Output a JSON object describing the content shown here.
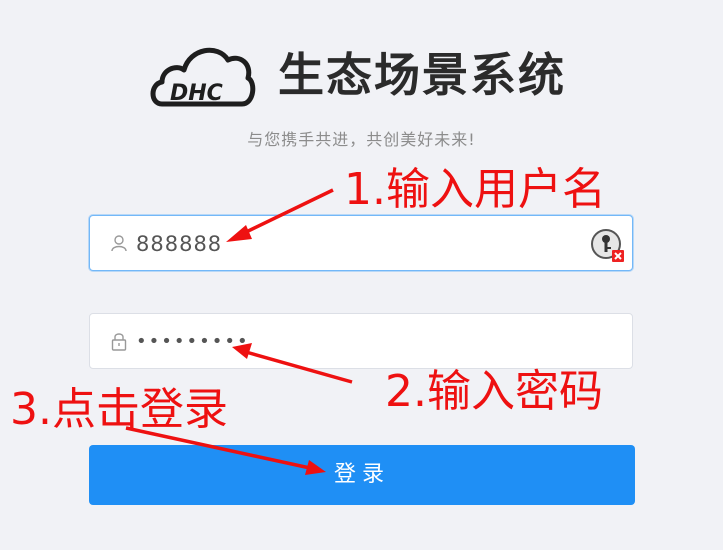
{
  "logo": {
    "text": "DHC"
  },
  "app": {
    "title": "生态场景系统",
    "slogan": "与您携手共进，共创美好未来!"
  },
  "form": {
    "username_value": "888888",
    "password_mask": "•••••••••",
    "login_label": "登录"
  },
  "annotations": {
    "step1": "1.输入用户名",
    "step2": "2.输入密码",
    "step3": "3.点击登录"
  },
  "colors": {
    "primary": "#1f8ff5",
    "annotation": "#ee1111",
    "background": "#f1f2f6"
  },
  "icons": {
    "username": "user-icon",
    "password": "lock-icon",
    "autofill": "key-icon"
  }
}
